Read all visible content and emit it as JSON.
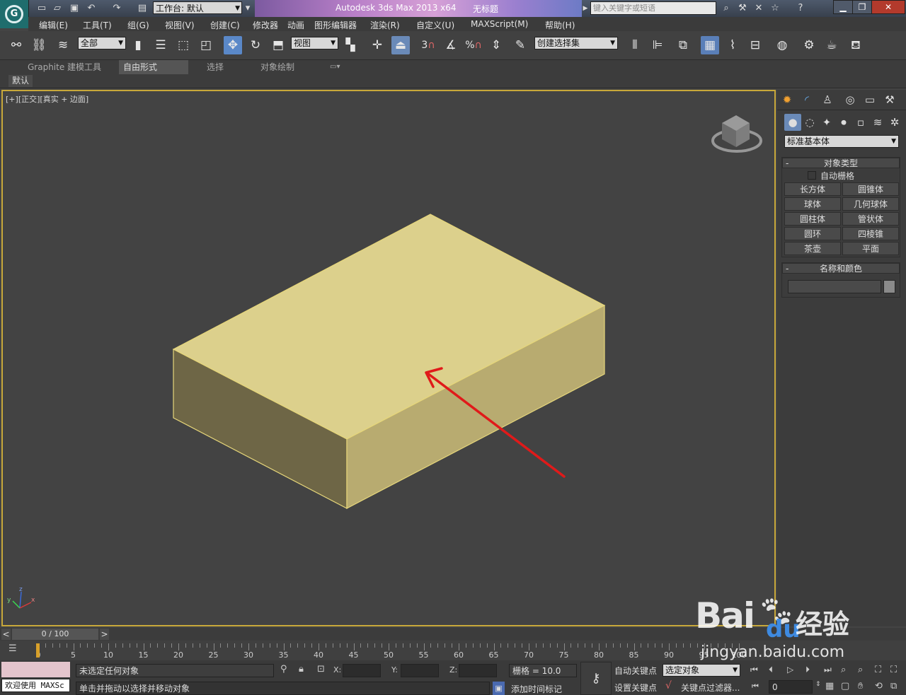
{
  "titlebar": {
    "workspace_label": "工作台: 默认",
    "app_title": "Autodesk 3ds Max  2013 x64",
    "doc_title": "无标题",
    "search_placeholder": "键入关键字或短语"
  },
  "menu": [
    "编辑(E)",
    "工具(T)",
    "组(G)",
    "视图(V)",
    "创建(C)",
    "修改器",
    "动画",
    "图形编辑器",
    "渲染(R)",
    "自定义(U)",
    "MAXScript(M)",
    "帮助(H)"
  ],
  "toolbar": {
    "selection_filter": "全部",
    "ref_coord": "视图",
    "snap_3": "3",
    "snap_percent": "%",
    "named_selection": "创建选择集"
  },
  "ribbon": {
    "tabs": [
      "Graphite 建模工具",
      "自由形式",
      "选择",
      "对象绘制"
    ],
    "selected_tab": 1,
    "sub_tab": "默认"
  },
  "viewport": {
    "label": "[+][正交][真实 + 边面]",
    "label_plus": "[+]",
    "label_view": "[正交]",
    "label_shade": "[真实 + 边面]",
    "box_colors": {
      "top": "#dcd08c",
      "left": "#6e6646",
      "right": "#b8ab70",
      "edge": "#e6d67a"
    },
    "arrow_color": "#e01a1a",
    "axis": {
      "x": "x",
      "y": "y",
      "z": "z"
    }
  },
  "command_panel": {
    "category": "标准基本体",
    "object_type_title": "对象类型",
    "autogrid_label": "自动栅格",
    "buttons": [
      [
        "长方体",
        "圆锥体"
      ],
      [
        "球体",
        "几何球体"
      ],
      [
        "圆柱体",
        "管状体"
      ],
      [
        "圆环",
        "四棱锥"
      ],
      [
        "茶壶",
        "平面"
      ]
    ],
    "name_color_title": "名称和颜色"
  },
  "timeline": {
    "frame_label": "0 / 100",
    "prev": "<",
    "next": ">",
    "ticks": [
      "0",
      "5",
      "10",
      "15",
      "20",
      "25",
      "30",
      "35",
      "40",
      "45",
      "50",
      "55",
      "60",
      "65",
      "70",
      "75",
      "80",
      "85",
      "90",
      "95",
      "100"
    ]
  },
  "status": {
    "maxscript": "欢迎使用 MAXSc",
    "selection_msg": "未选定任何对象",
    "prompt_msg": "单击并拖动以选择并移动对象",
    "x_label": "X:",
    "y_label": "Y:",
    "z_label": "Z:",
    "grid": "栅格 = 10.0",
    "add_time_tag": "添加时间标记",
    "auto_key": "自动关键点",
    "set_key": "设置关键点",
    "selected_object": "选定对象",
    "key_filters": "关键点过滤器...",
    "frame_value": "0"
  },
  "watermark": {
    "brand": "Bai",
    "brand2": "du",
    "cn": "经验",
    "url": "jingyan.baidu.com"
  }
}
